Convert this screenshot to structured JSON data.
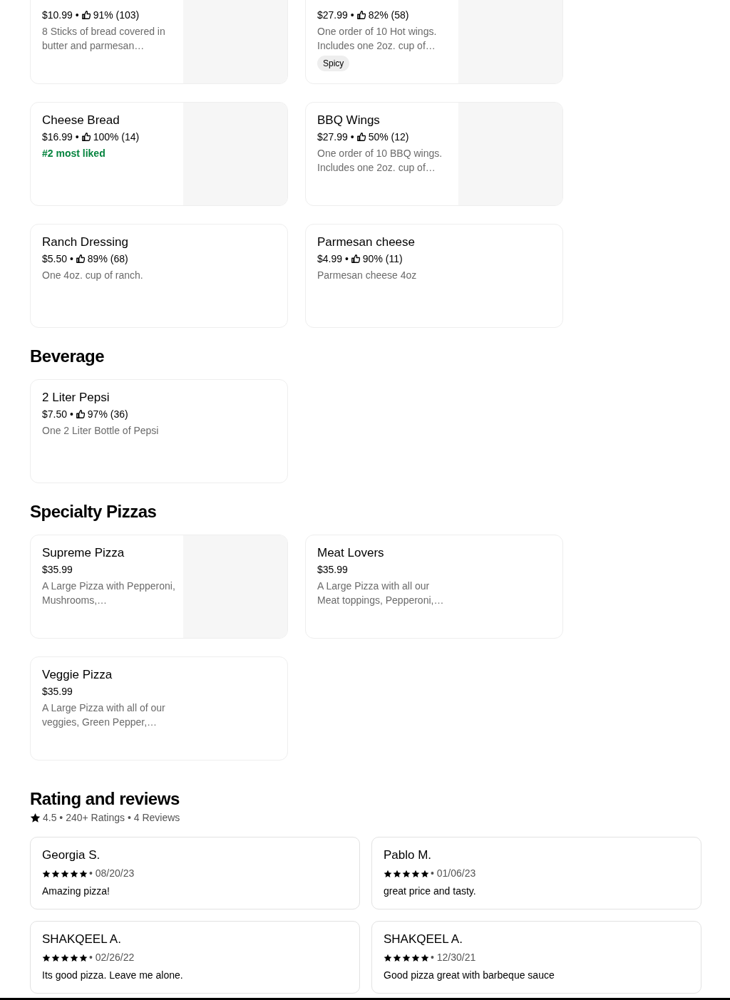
{
  "sections": [
    {
      "items": [
        {
          "price": "$10.99 •",
          "likes": "91% (103)",
          "description": "8 Sticks of bread covered in butter and parmesan…",
          "has_image": true
        },
        {
          "price": "$27.99 •",
          "likes": "82% (58)",
          "description": "One order of 10 Hot wings. Includes one 2oz. cup of…",
          "badge": "Spicy",
          "has_image": true
        },
        {
          "name": "Cheese Bread",
          "price": "$16.99 •",
          "likes": "100% (14)",
          "highlight": "#2 most liked",
          "has_image": true
        },
        {
          "name": "BBQ Wings",
          "price": "$27.99 •",
          "likes": "50% (12)",
          "description": "One order of 10 BBQ wings. Includes one 2oz. cup of…",
          "has_image": true
        },
        {
          "name": "Ranch Dressing",
          "price": "$5.50 •",
          "likes": "89% (68)",
          "description": "One 4oz. cup of ranch.",
          "has_image": false
        },
        {
          "name": "Parmesan cheese",
          "price": "$4.99 •",
          "likes": "90% (11)",
          "description": "Parmesan cheese 4oz",
          "has_image": false
        }
      ]
    },
    {
      "title": "Beverage",
      "items": [
        {
          "name": "2 Liter Pepsi",
          "price": "$7.50 •",
          "likes": "97% (36)",
          "description": "One 2 Liter Bottle of Pepsi",
          "has_image": false
        }
      ]
    },
    {
      "title": "Specialty Pizzas",
      "items": [
        {
          "name": "Supreme Pizza",
          "price": "$35.99",
          "description": "A Large Pizza with Pepperoni, Mushrooms,…",
          "has_image": true
        },
        {
          "name": "Meat Lovers",
          "price": "$35.99",
          "description": "A Large Pizza with all our Meat toppings, Pepperoni,…",
          "has_image": false
        },
        {
          "name": "Veggie Pizza",
          "price": "$35.99",
          "description": "A Large Pizza with all of our veggies, Green Pepper,…",
          "has_image": false
        }
      ]
    }
  ],
  "reviews": {
    "title": "Rating and reviews",
    "summary": "4.5 • 240+ Ratings • 4 Reviews",
    "items": [
      {
        "name": "Georgia S.",
        "stars": 5,
        "date": "• 08/20/23",
        "text": "Amazing pizza!"
      },
      {
        "name": "Pablo M.",
        "stars": 5,
        "date": "• 01/06/23",
        "text": "great price and tasty."
      },
      {
        "name": "SHAKQEEL A.",
        "stars": 5,
        "date": "• 02/26/22",
        "text": "Its good pizza. Leave me alone."
      },
      {
        "name": "SHAKQEEL A.",
        "stars": 5,
        "date": "• 12/30/21",
        "text": "Good pizza great with barbeque sauce"
      }
    ]
  }
}
